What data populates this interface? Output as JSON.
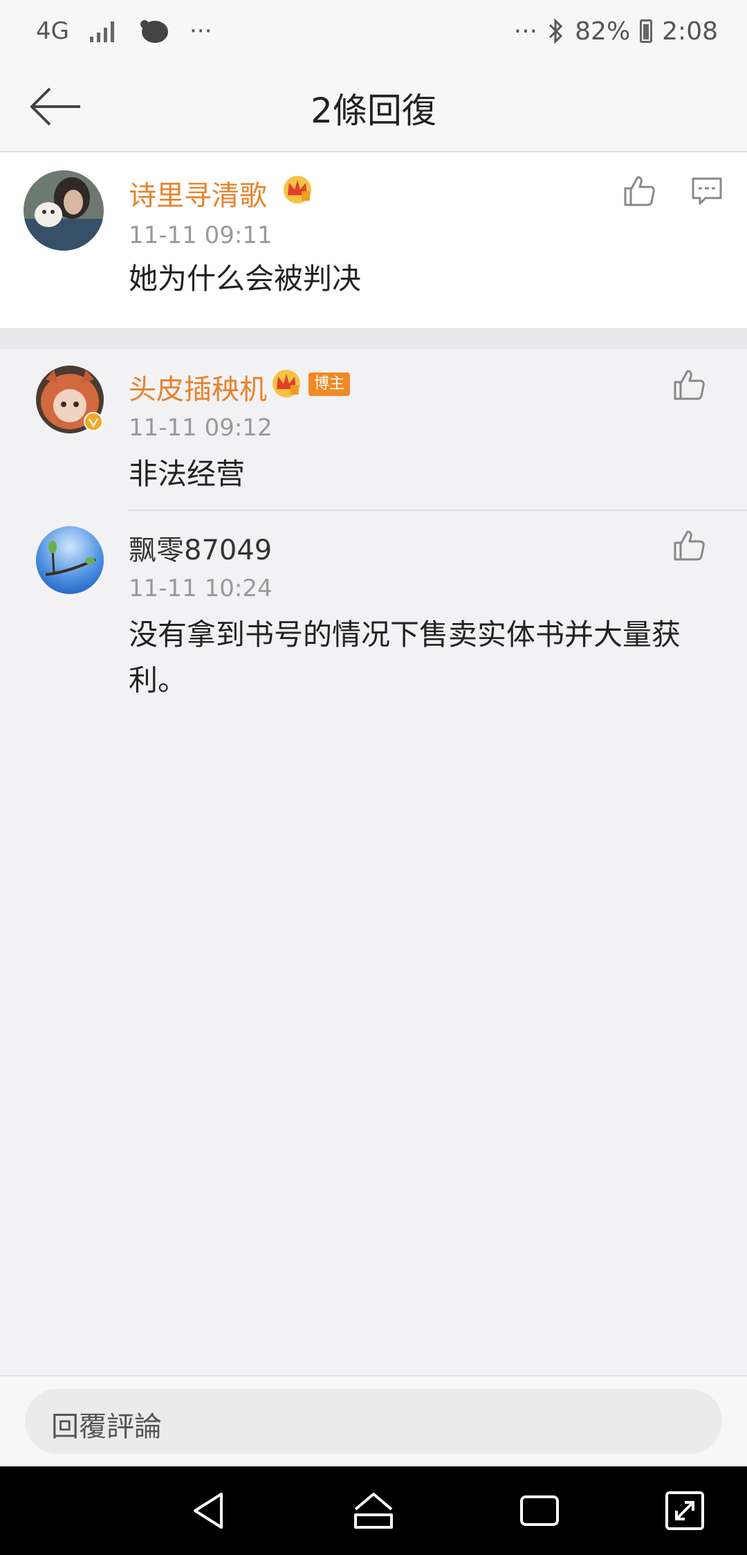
{
  "status_bar": {
    "network": "4G",
    "dots_left": "···",
    "dots_right": "···",
    "battery": "82%",
    "time": "2:08"
  },
  "header": {
    "title": "2條回復"
  },
  "top_comment": {
    "name": "诗里寻清歌",
    "time": "11-11 09:11",
    "text": "她为什么会被判决"
  },
  "replies": [
    {
      "name": "头皮插秧机",
      "badge": "博主",
      "time": "11-11 09:12",
      "text": "非法经营"
    },
    {
      "name": "飘零87049",
      "time": "11-11 10:24",
      "text": "没有拿到书号的情况下售卖实体书并大量获利。"
    }
  ],
  "input": {
    "placeholder": "回覆評論"
  },
  "colors": {
    "accent": "#e8822b",
    "badge": "#f08a24"
  }
}
